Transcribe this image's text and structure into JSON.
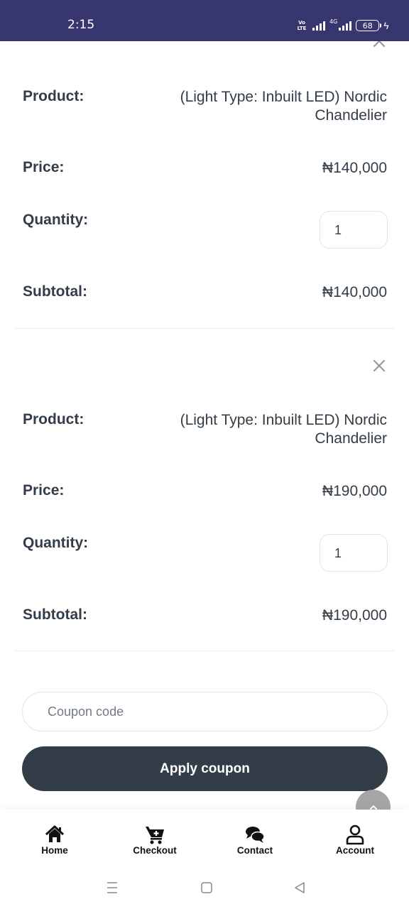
{
  "status_bar": {
    "time": "2:15",
    "volte": "Vo LTE",
    "network": "4G",
    "battery": "68"
  },
  "currency_symbol": "₦",
  "labels": {
    "product": "Product:",
    "price": "Price:",
    "quantity": "Quantity:",
    "subtotal": "Subtotal:"
  },
  "cart_items": [
    {
      "product": "(Light Type: Inbuilt LED) Nordic Chandelier",
      "price": "₦140,000",
      "quantity": "1",
      "subtotal": "₦140,000"
    },
    {
      "product": "(Light Type: Inbuilt LED) Nordic Chandelier",
      "price": "₦190,000",
      "quantity": "1",
      "subtotal": "₦190,000"
    }
  ],
  "coupon": {
    "placeholder": "Coupon code",
    "apply_label": "Apply coupon"
  },
  "bottom_nav": [
    {
      "label": "Home",
      "icon": "home-icon"
    },
    {
      "label": "Checkout",
      "icon": "cart-plus-icon"
    },
    {
      "label": "Contact",
      "icon": "chat-bubbles-icon"
    },
    {
      "label": "Account",
      "icon": "user-icon"
    }
  ],
  "colors": {
    "status_bar": "#38366f",
    "primary_dark": "#333d48",
    "scroll_button": "#a6a6a6"
  }
}
